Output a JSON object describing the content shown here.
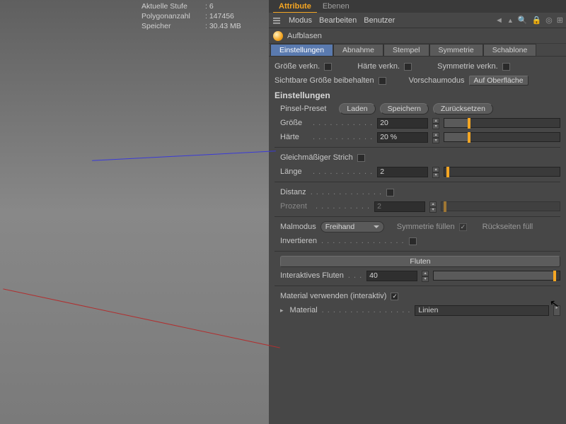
{
  "viewport": {
    "stats": {
      "level_label": "Aktuelle Stufe",
      "level_value": ": 6",
      "poly_label": "Polygonanzahl",
      "poly_value": ": 147456",
      "mem_label": "Speicher",
      "mem_value": ": 30.43 MB"
    }
  },
  "panel": {
    "tabs": {
      "attribute": "Attribute",
      "ebenen": "Ebenen"
    },
    "menu": {
      "modus": "Modus",
      "bearbeiten": "Bearbeiten",
      "benutzer": "Benutzer"
    },
    "tool_name": "Aufblasen",
    "subtabs": {
      "einstellungen": "Einstellungen",
      "abnahme": "Abnahme",
      "stempel": "Stempel",
      "symmetrie": "Symmetrie",
      "schablone": "Schablone"
    },
    "toprow": {
      "groesse_verkn": "Größe verkn.",
      "haerte_verkn": "Härte verkn.",
      "symmetrie_verkn": "Symmetrie verkn."
    },
    "secondrow": {
      "sichtbar": "Sichtbare Größe beibehalten",
      "vorschau": "Vorschaumodus",
      "auf_ober": "Auf Oberfläche"
    },
    "section_header": "Einstellungen",
    "preset": {
      "label": "Pinsel-Preset",
      "laden": "Laden",
      "speichern": "Speichern",
      "zuruecksetzen": "Zurücksetzen"
    },
    "groesse": {
      "label": "Größe",
      "value": "20",
      "pct": 20
    },
    "haerte": {
      "label": "Härte",
      "value": "20 %",
      "pct": 20
    },
    "gleich": "Gleichmäßiger Strich",
    "laenge": {
      "label": "Länge",
      "value": "2",
      "pct": 2
    },
    "distanz": "Distanz",
    "prozent": {
      "label": "Prozent",
      "value": "2",
      "pct": 2
    },
    "malmodus": {
      "label": "Malmodus",
      "value": "Freihand"
    },
    "sym_fuellen": "Symmetrie füllen",
    "rueckseiten": "Rückseiten füll",
    "invertieren": "Invertieren",
    "fluten_btn": "Fluten",
    "inter_fluten": {
      "label": "Interaktives Fluten",
      "value": "40",
      "pct": 95
    },
    "mat_verwenden": "Material verwenden (interaktiv)",
    "material": {
      "label": "Material",
      "value": "Linien"
    }
  }
}
